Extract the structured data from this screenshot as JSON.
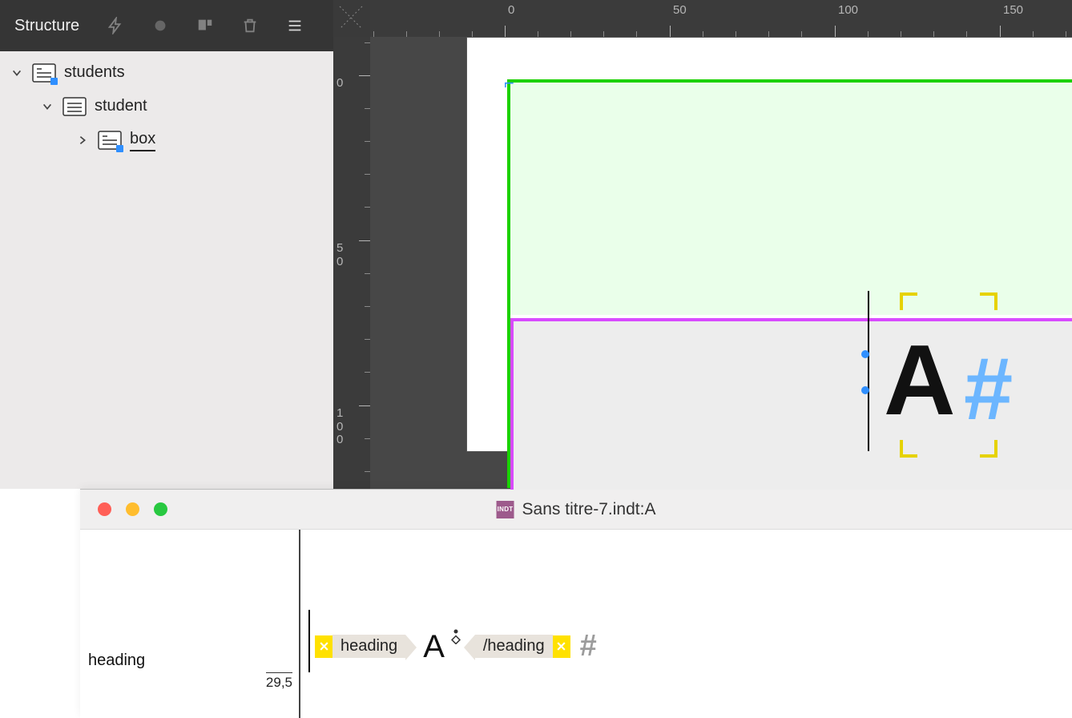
{
  "panel": {
    "title": "Structure",
    "tree": {
      "root": {
        "label": "students"
      },
      "child1": {
        "label": "student"
      },
      "child2": {
        "label": "box"
      }
    }
  },
  "ruler": {
    "top": {
      "t0": "0",
      "t50": "50",
      "t100": "100",
      "t150": "150"
    },
    "left": {
      "t0": "0",
      "t50d1": "5",
      "t50d2": "0",
      "t100d1": "1",
      "t100d2": "0",
      "t100d3": "0"
    }
  },
  "canvas": {
    "bigGlyph": "A",
    "hashGlyph": "#"
  },
  "storyEditor": {
    "windowTitle": "Sans titre-7.indt:A",
    "styleName": "heading",
    "styleSize": "29,5",
    "openTag": "heading",
    "closeTag": "/heading",
    "content": "A",
    "endMark": "#"
  }
}
